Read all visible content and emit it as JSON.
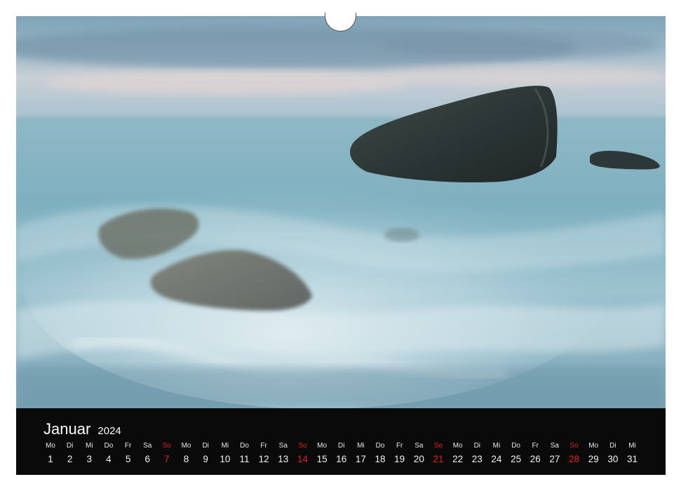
{
  "calendar": {
    "month": "Januar",
    "year": "2024",
    "days": [
      {
        "wd": "Mo",
        "d": "1",
        "sun": false
      },
      {
        "wd": "Di",
        "d": "2",
        "sun": false
      },
      {
        "wd": "Mi",
        "d": "3",
        "sun": false
      },
      {
        "wd": "Do",
        "d": "4",
        "sun": false
      },
      {
        "wd": "Fr",
        "d": "5",
        "sun": false
      },
      {
        "wd": "Sa",
        "d": "6",
        "sun": false
      },
      {
        "wd": "So",
        "d": "7",
        "sun": true
      },
      {
        "wd": "Mo",
        "d": "8",
        "sun": false
      },
      {
        "wd": "Di",
        "d": "9",
        "sun": false
      },
      {
        "wd": "Mi",
        "d": "10",
        "sun": false
      },
      {
        "wd": "Do",
        "d": "11",
        "sun": false
      },
      {
        "wd": "Fr",
        "d": "12",
        "sun": false
      },
      {
        "wd": "Sa",
        "d": "13",
        "sun": false
      },
      {
        "wd": "So",
        "d": "14",
        "sun": true
      },
      {
        "wd": "Mo",
        "d": "15",
        "sun": false
      },
      {
        "wd": "Di",
        "d": "16",
        "sun": false
      },
      {
        "wd": "Mi",
        "d": "17",
        "sun": false
      },
      {
        "wd": "Do",
        "d": "18",
        "sun": false
      },
      {
        "wd": "Fr",
        "d": "19",
        "sun": false
      },
      {
        "wd": "Sa",
        "d": "20",
        "sun": false
      },
      {
        "wd": "So",
        "d": "21",
        "sun": true
      },
      {
        "wd": "Mo",
        "d": "22",
        "sun": false
      },
      {
        "wd": "Di",
        "d": "23",
        "sun": false
      },
      {
        "wd": "Mi",
        "d": "24",
        "sun": false
      },
      {
        "wd": "Do",
        "d": "25",
        "sun": false
      },
      {
        "wd": "Fr",
        "d": "26",
        "sun": false
      },
      {
        "wd": "Sa",
        "d": "27",
        "sun": false
      },
      {
        "wd": "So",
        "d": "28",
        "sun": true
      },
      {
        "wd": "Mo",
        "d": "29",
        "sun": false
      },
      {
        "wd": "Di",
        "d": "30",
        "sun": false
      },
      {
        "wd": "Mi",
        "d": "31",
        "sun": false
      }
    ]
  },
  "photo": {
    "subject": "boulders-in-surf-seascape-photo"
  },
  "colors": {
    "sunday": "#e0231b",
    "calendar_bg": "#0a0a0a",
    "sea": "#8fb6c4"
  }
}
